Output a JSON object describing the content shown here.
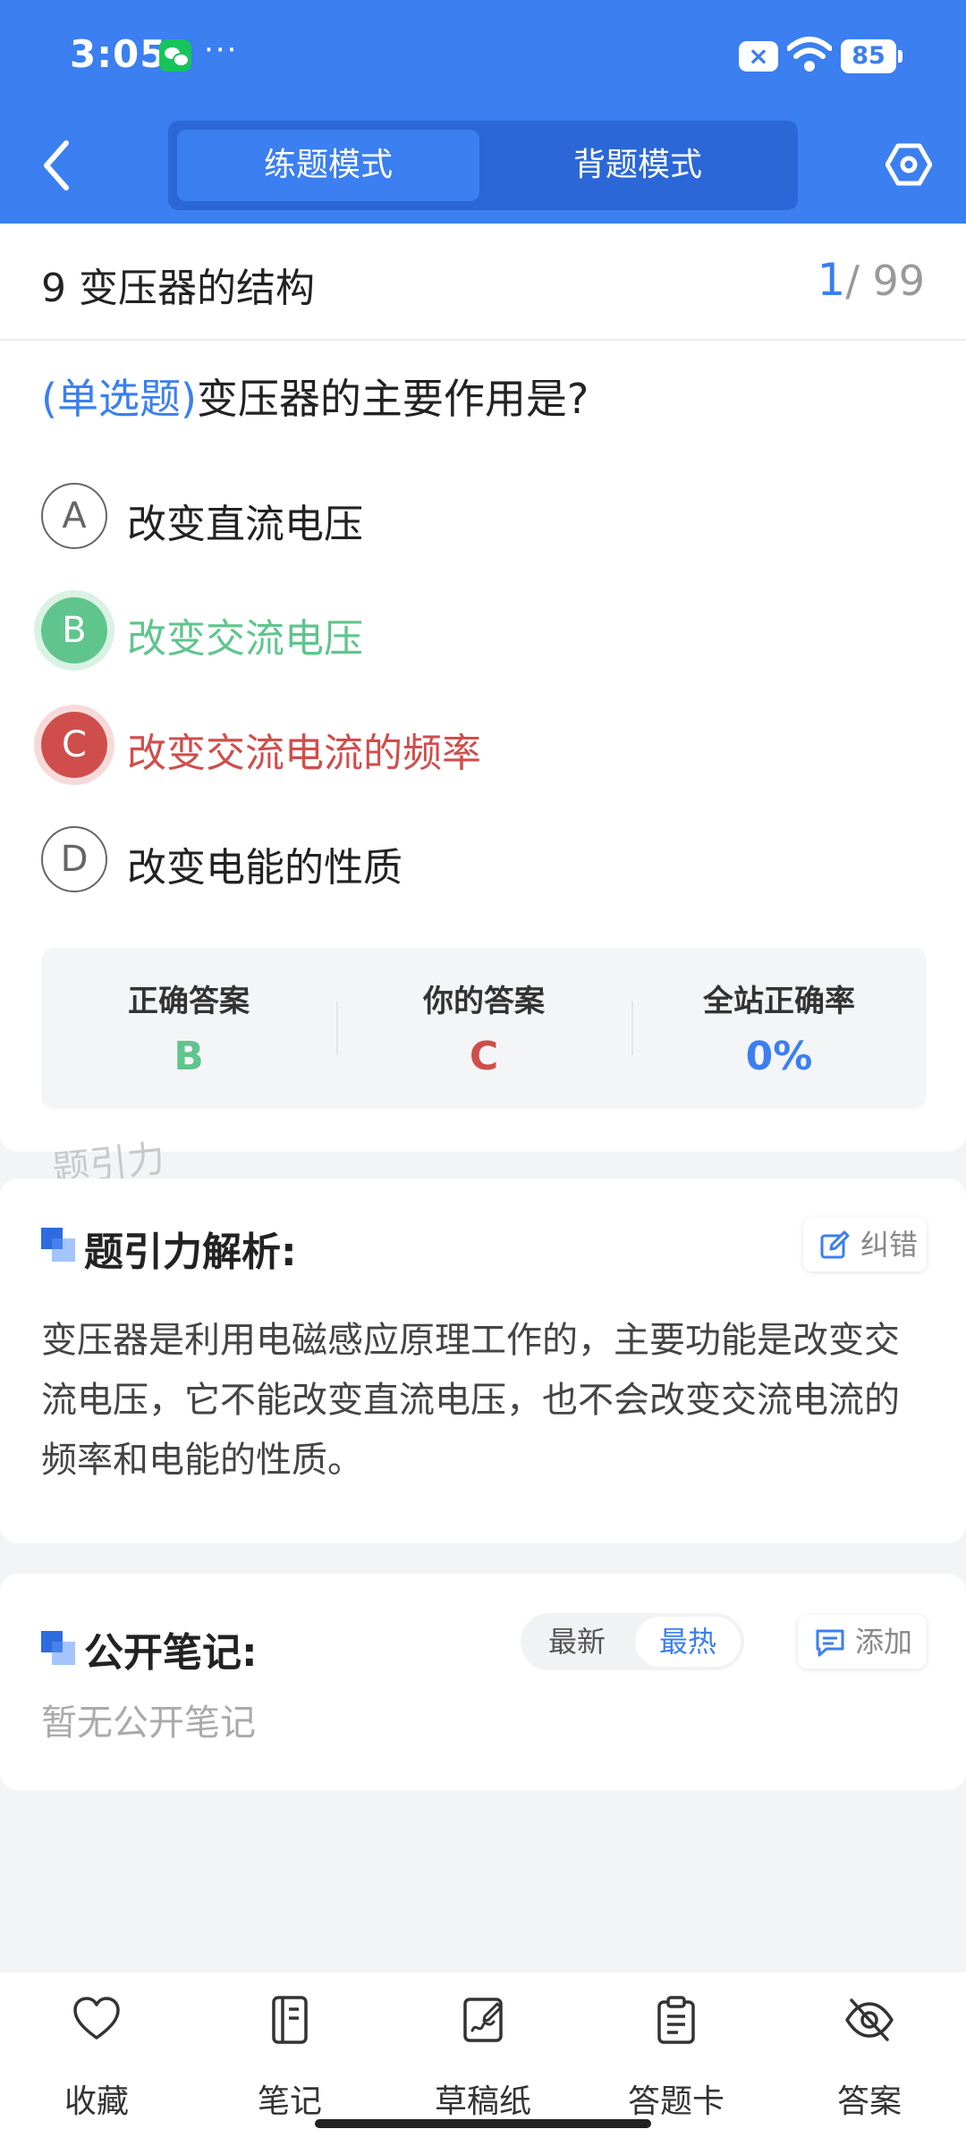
{
  "status_bar": {
    "time": "3:05",
    "dots": "···",
    "x_badge": "×",
    "battery": "85"
  },
  "header": {
    "modes": [
      "练题模式",
      "背题模式"
    ],
    "active_mode": "练题模式"
  },
  "question_card": {
    "chapter": "9 变压器的结构",
    "progress": {
      "current": "1",
      "total": "/ 99"
    },
    "question": {
      "type": "(单选题)",
      "text": "变压器的主要作用是?"
    },
    "options": [
      {
        "letter": "A",
        "text": "改变直流电压",
        "state": "normal"
      },
      {
        "letter": "B",
        "text": "改变交流电压",
        "state": "correct"
      },
      {
        "letter": "C",
        "text": "改变交流电流的频率",
        "state": "wrong"
      },
      {
        "letter": "D",
        "text": "改变电能的性质",
        "state": "normal"
      }
    ],
    "stats": {
      "correct_answer": {
        "label": "正确答案",
        "value": "B"
      },
      "your_answer": {
        "label": "你的答案",
        "value": "C"
      },
      "site_rate": {
        "label": "全站正确率",
        "value": "0%"
      }
    }
  },
  "watermark": "题引力",
  "analysis": {
    "title": "题引力解析:",
    "report_label": "纠错",
    "text": "变压器是利用电磁感应原理工作的，主要功能是改变交流电压，它不能改变直流电压，也不会改变交流电流的频率和电能的性质。"
  },
  "notes": {
    "title": "公开笔记:",
    "sort_options": [
      "最新",
      "最热"
    ],
    "active_sort": "最热",
    "add_label": "添加",
    "empty_text": "暂无公开笔记"
  },
  "bottom_tabs": [
    {
      "label": "收藏",
      "icon": "heart-icon"
    },
    {
      "label": "笔记",
      "icon": "notebook-icon"
    },
    {
      "label": "草稿纸",
      "icon": "draft-paper-icon"
    },
    {
      "label": "答题卡",
      "icon": "answer-sheet-icon"
    },
    {
      "label": "答案",
      "icon": "eye-off-icon"
    }
  ],
  "colors": {
    "primary": "#3b7ff0",
    "correct": "#5fc58c",
    "wrong": "#cf4e4b"
  }
}
